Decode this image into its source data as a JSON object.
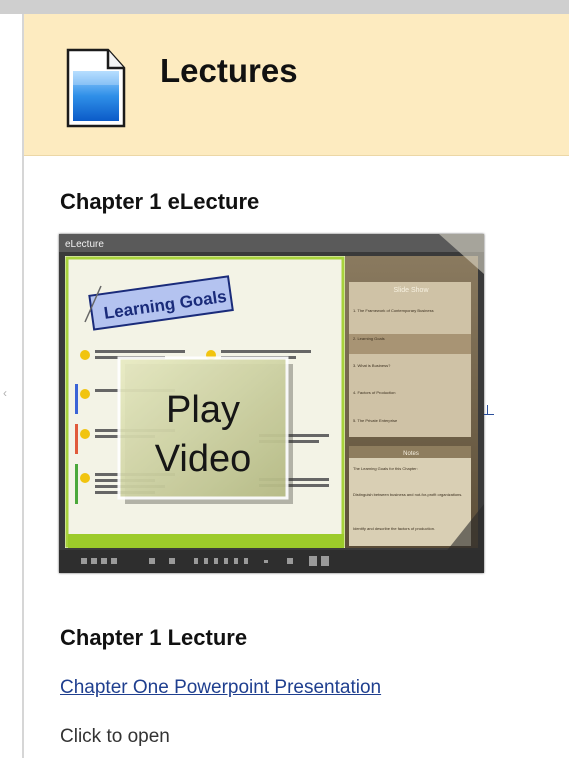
{
  "header": {
    "title": "Lectures",
    "icon": "document-icon",
    "background": "#fdebc0"
  },
  "sections": [
    {
      "heading": "Chapter 1 eLecture",
      "video": {
        "window_title": "eLecture",
        "slide_title": "Learning Goals",
        "play_label": [
          "Play",
          "Video"
        ],
        "slide_show_label": "Slide Show",
        "slide_list": [
          "1. The Framework of Contemporary Business",
          "2. Learning Goals",
          "3. What is Business?",
          "4. Factors of Production",
          "5. The Private Enterprise"
        ],
        "notes_label": "Notes",
        "notes_text": [
          "The Learning Goals for this Chapter:",
          "Distinguish between business and not-for-profit organizations.",
          "Identify and describe the factors of production."
        ]
      }
    },
    {
      "heading": "Chapter 1 Lecture",
      "link_text": "Chapter One Powerpoint Presentation",
      "note": "Click to open"
    }
  ]
}
